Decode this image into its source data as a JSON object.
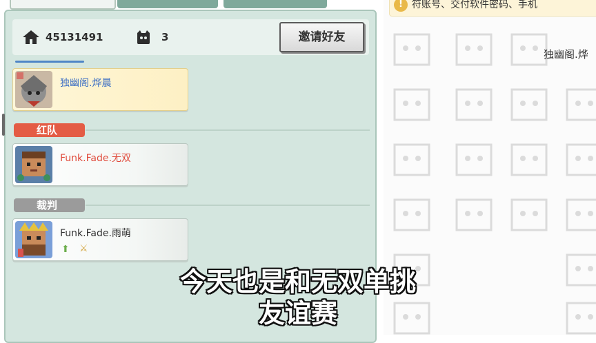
{
  "room": {
    "room_id": "45131491",
    "player_count": "3",
    "invite_button": "邀请好友"
  },
  "host": {
    "name": "独幽阁.烨晨",
    "name_color": "#3d6fc4"
  },
  "teams": {
    "red_label": "红队",
    "red_color": "#e45c45",
    "red_member": "Funk.Fade.无双",
    "judge_label": "裁判",
    "judge_color": "#9b9b9b",
    "judge_member": "Funk.Fade.雨萌"
  },
  "right": {
    "notice_text": "符账号、交付软件密码、手机",
    "host_name_partial": "独幽阁.烨"
  },
  "subtitles": {
    "line1": "今天也是和无双单挑",
    "line2": "友谊赛"
  }
}
